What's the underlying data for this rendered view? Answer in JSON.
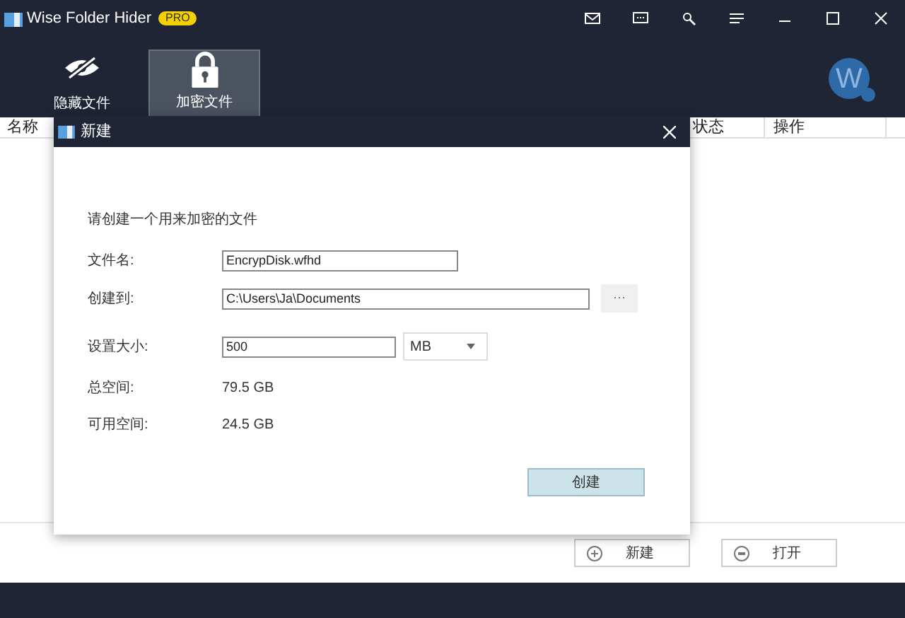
{
  "window": {
    "title": "Wise Folder Hider",
    "badge": "PRO"
  },
  "title_buttons": [
    {
      "kind": "mail"
    },
    {
      "kind": "chat"
    },
    {
      "kind": "tools"
    },
    {
      "kind": "menu"
    },
    {
      "kind": "minimize"
    },
    {
      "kind": "maximize"
    },
    {
      "kind": "close"
    }
  ],
  "tabs": [
    {
      "label": "隐藏文件",
      "kind": "hide",
      "selected": false
    },
    {
      "label": "加密文件",
      "kind": "lock",
      "selected": true
    }
  ],
  "avatar": {
    "letter": "W"
  },
  "table": {
    "columns": [
      {
        "label": "名称",
        "kind": "name"
      },
      {
        "label": "状态",
        "kind": "status"
      },
      {
        "label": "操作",
        "kind": "action"
      }
    ]
  },
  "bottom_buttons": [
    {
      "label": "新建",
      "kind": "plus"
    },
    {
      "label": "打开",
      "kind": "open"
    }
  ],
  "dialog": {
    "title": "新建",
    "prompt": "请创建一个用来加密的文件",
    "file_name": {
      "label": "文件名:",
      "value": "EncrypDisk.wfhd"
    },
    "location": {
      "label": "创建到:",
      "value": "C:\\Users\\Ja\\Documents",
      "browse": "···"
    },
    "size": {
      "label": "设置大小:",
      "value": "500",
      "unit": "MB"
    },
    "info": [
      {
        "label": "总空间:",
        "value": "79.5 GB"
      },
      {
        "label": "可用空间:",
        "value": "24.5 GB"
      }
    ],
    "create_button": "创建"
  }
}
